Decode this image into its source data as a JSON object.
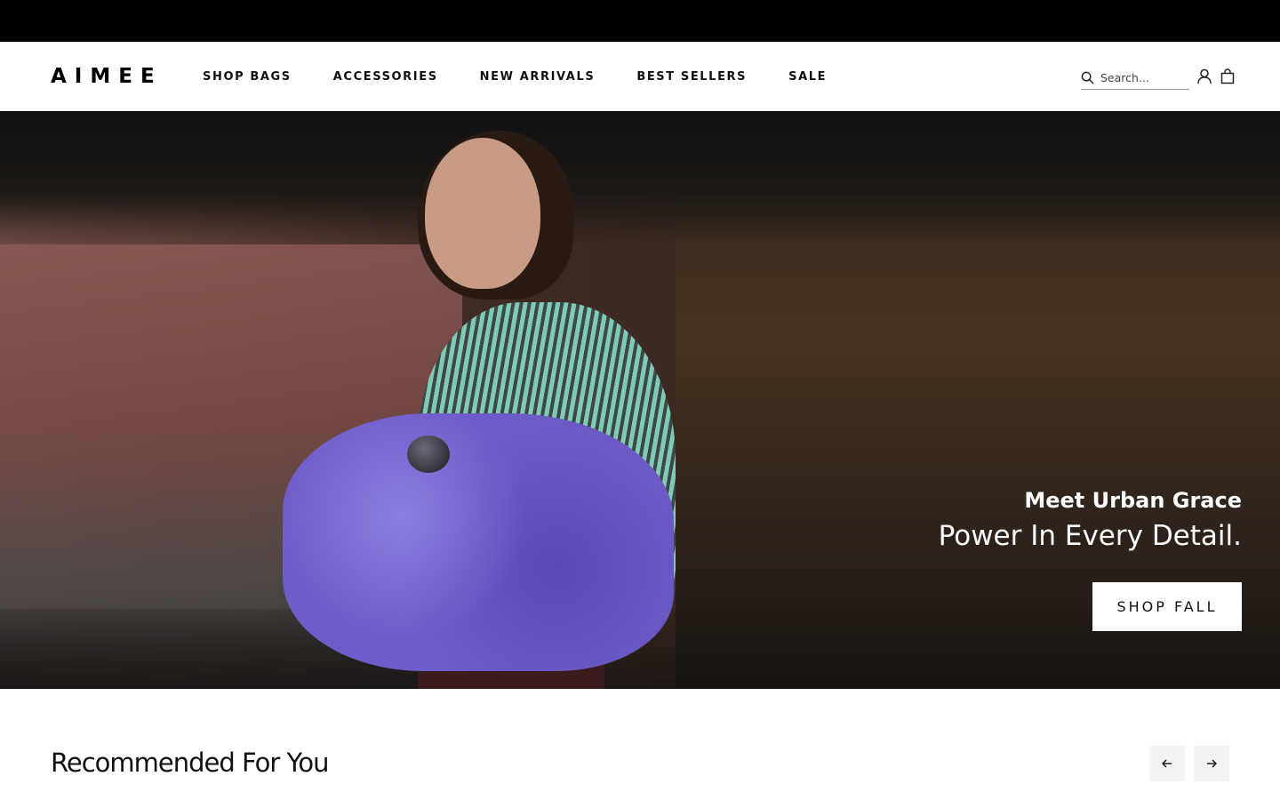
{
  "brand": {
    "logo": "AIMEE"
  },
  "nav": {
    "items": [
      {
        "label": "SHOP BAGS"
      },
      {
        "label": "ACCESSORIES"
      },
      {
        "label": "NEW ARRIVALS"
      },
      {
        "label": "BEST SELLERS"
      },
      {
        "label": "SALE"
      }
    ]
  },
  "search": {
    "placeholder": "Search..."
  },
  "icons": {
    "search": "search-icon",
    "account": "user-icon",
    "cart": "shopping-bag-icon",
    "prev": "arrow-left-icon",
    "next": "arrow-right-icon"
  },
  "hero": {
    "eyebrow": "Meet Urban Grace",
    "title": "Power In Every Detail.",
    "cta_label": "SHOP FALL"
  },
  "recommended": {
    "title": "Recommended For You"
  }
}
